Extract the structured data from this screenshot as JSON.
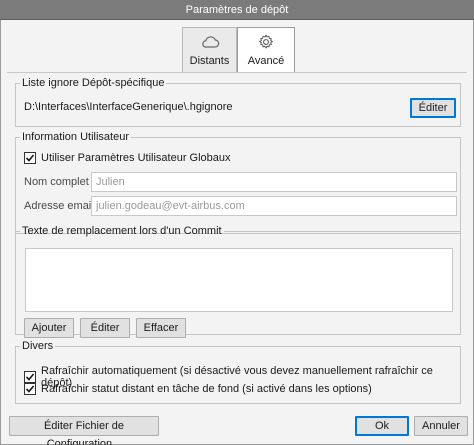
{
  "window": {
    "title": "Paramètres de dépôt"
  },
  "tabs": [
    {
      "label": "Distants",
      "icon": "cloud-icon",
      "active": false
    },
    {
      "label": "Avancé",
      "icon": "gear-icon",
      "active": true
    }
  ],
  "ignore_list": {
    "legend": "Liste ignore Dépôt-spécifique",
    "path": "D:\\Interfaces\\InterfaceGenerique\\.hgignore",
    "edit_button": "Éditer"
  },
  "user_info": {
    "legend": "Information Utilisateur",
    "use_global_label": "Utiliser Paramètres Utilisateur Globaux",
    "use_global_checked": true,
    "fullname_label": "Nom complet :",
    "fullname_value": "Julien",
    "email_label": "Adresse email :",
    "email_value": "julien.godeau@evt-airbus.com"
  },
  "commit_text": {
    "legend": "Texte de remplacement lors d'un Commit",
    "add_button": "Ajouter",
    "edit_button": "Éditer",
    "clear_button": "Effacer"
  },
  "misc": {
    "legend": "Divers",
    "auto_refresh_label": "Rafraîchir automatiquement (si désactivé vous devez manuellement rafraîchir ce dépôt)",
    "auto_refresh_checked": true,
    "remote_refresh_label": "Rafraîchir statut distant en tâche de fond (si activé dans les options)",
    "remote_refresh_checked": true
  },
  "footer": {
    "edit_config_button": "Éditer Fichier de Configuration...",
    "ok_button": "Ok",
    "cancel_button": "Annuler"
  },
  "colors": {
    "focus": "#0078d7",
    "titlebar": "#7b7b7b"
  }
}
